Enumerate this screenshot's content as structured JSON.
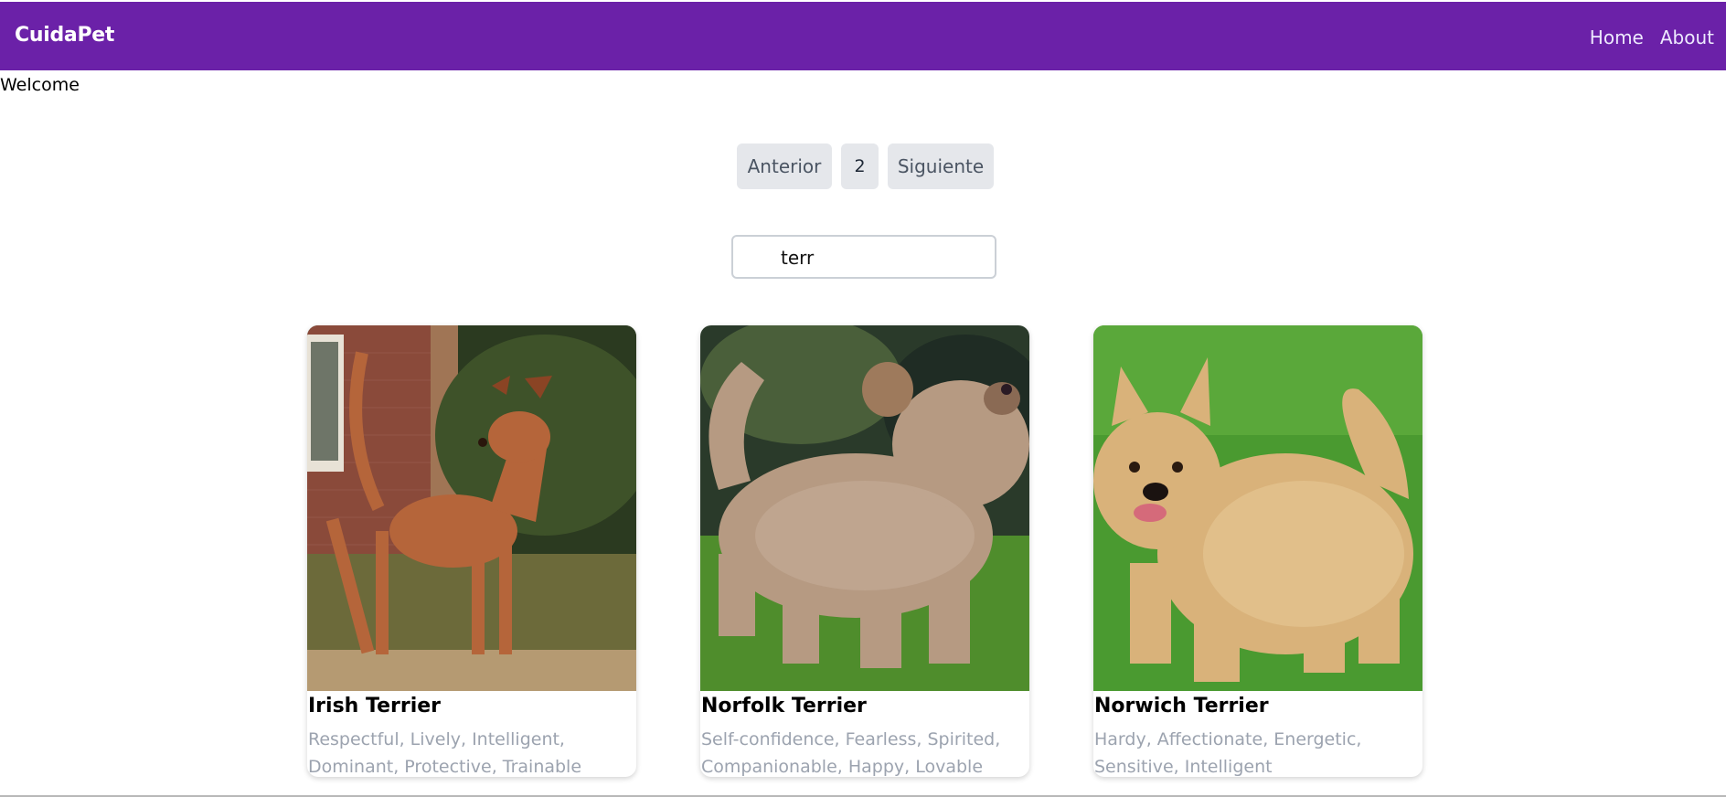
{
  "header": {
    "brand": "CuidaPet",
    "nav": [
      "Home",
      "About"
    ],
    "color": "#6b21a8"
  },
  "welcome": "Welcome",
  "pagination": {
    "prev_label": "Anterior",
    "page": "2",
    "next_label": "Siguiente"
  },
  "search": {
    "value": "terr",
    "icon": "search-icon"
  },
  "cards": [
    {
      "name": "Irish Terrier",
      "traits": "Respectful, Lively, Intelligent, Dominant, Protective, Trainable"
    },
    {
      "name": "Norfolk Terrier",
      "traits": "Self-confidence, Fearless, Spirited, Companionable, Happy, Lovable"
    },
    {
      "name": "Norwich Terrier",
      "traits": "Hardy, Affectionate, Energetic, Sensitive, Intelligent"
    }
  ]
}
